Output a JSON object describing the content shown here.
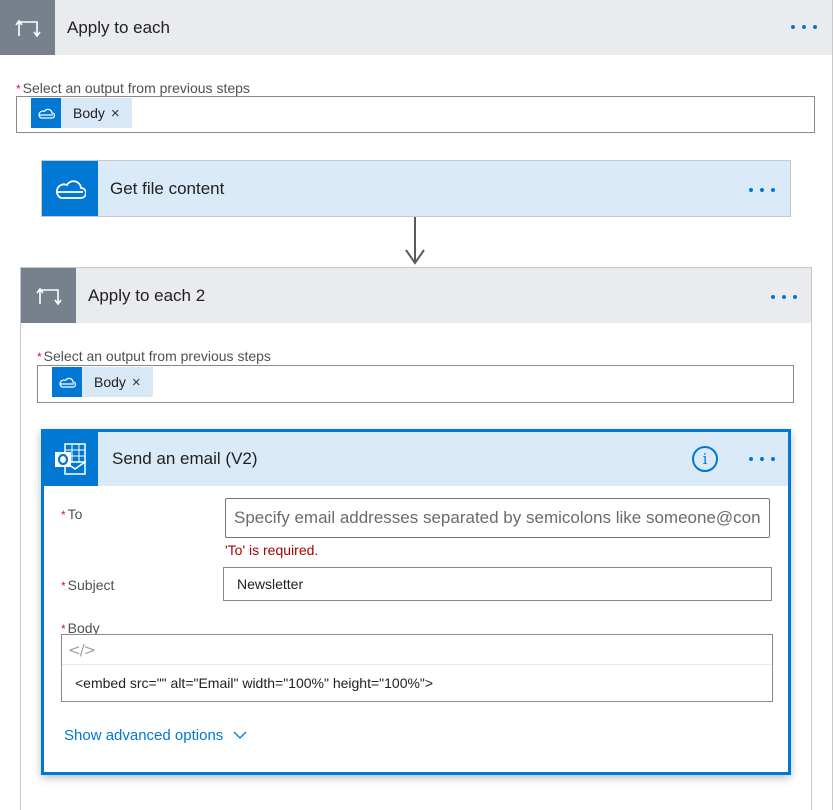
{
  "outer_loop": {
    "title": "Apply to each",
    "icon": "loop-icon",
    "menu_icon": "more-options-icon",
    "field_label": "Select an output from previous steps",
    "required_marker": "*",
    "token": {
      "label": "Body",
      "icon": "onedrive-icon",
      "remove": "×"
    }
  },
  "get_file_action": {
    "title": "Get file content",
    "icon": "onedrive-icon",
    "menu_icon": "more-options-icon"
  },
  "inner_loop": {
    "title": "Apply to each 2",
    "icon": "loop-icon",
    "menu_icon": "more-options-icon",
    "field_label": "Select an output from previous steps",
    "required_marker": "*",
    "token": {
      "label": "Body",
      "icon": "onedrive-icon",
      "remove": "×"
    }
  },
  "send_email": {
    "title": "Send an email (V2)",
    "icon": "outlook-icon",
    "info_icon": "i",
    "menu_icon": "more-options-icon",
    "fields": {
      "to": {
        "label": "To",
        "required_marker": "*",
        "value": "",
        "placeholder": "Specify email addresses separated by semicolons like someone@con",
        "error": "'To' is required."
      },
      "subject": {
        "label": "Subject",
        "required_marker": "*",
        "value": "Newsletter"
      },
      "body": {
        "label": "Body",
        "required_marker": "*",
        "toolbar_icon": "</>",
        "value": "<embed src=\"\" alt=\"Email\" width=\"100%\" height=\"100%\">"
      }
    },
    "advanced_link": "Show advanced options",
    "colors": {
      "accent": "#0078d4",
      "error": "#a80000",
      "required": "#e81123",
      "header_bg": "#daeaf8",
      "loop_icon_bg": "#77818e"
    }
  }
}
